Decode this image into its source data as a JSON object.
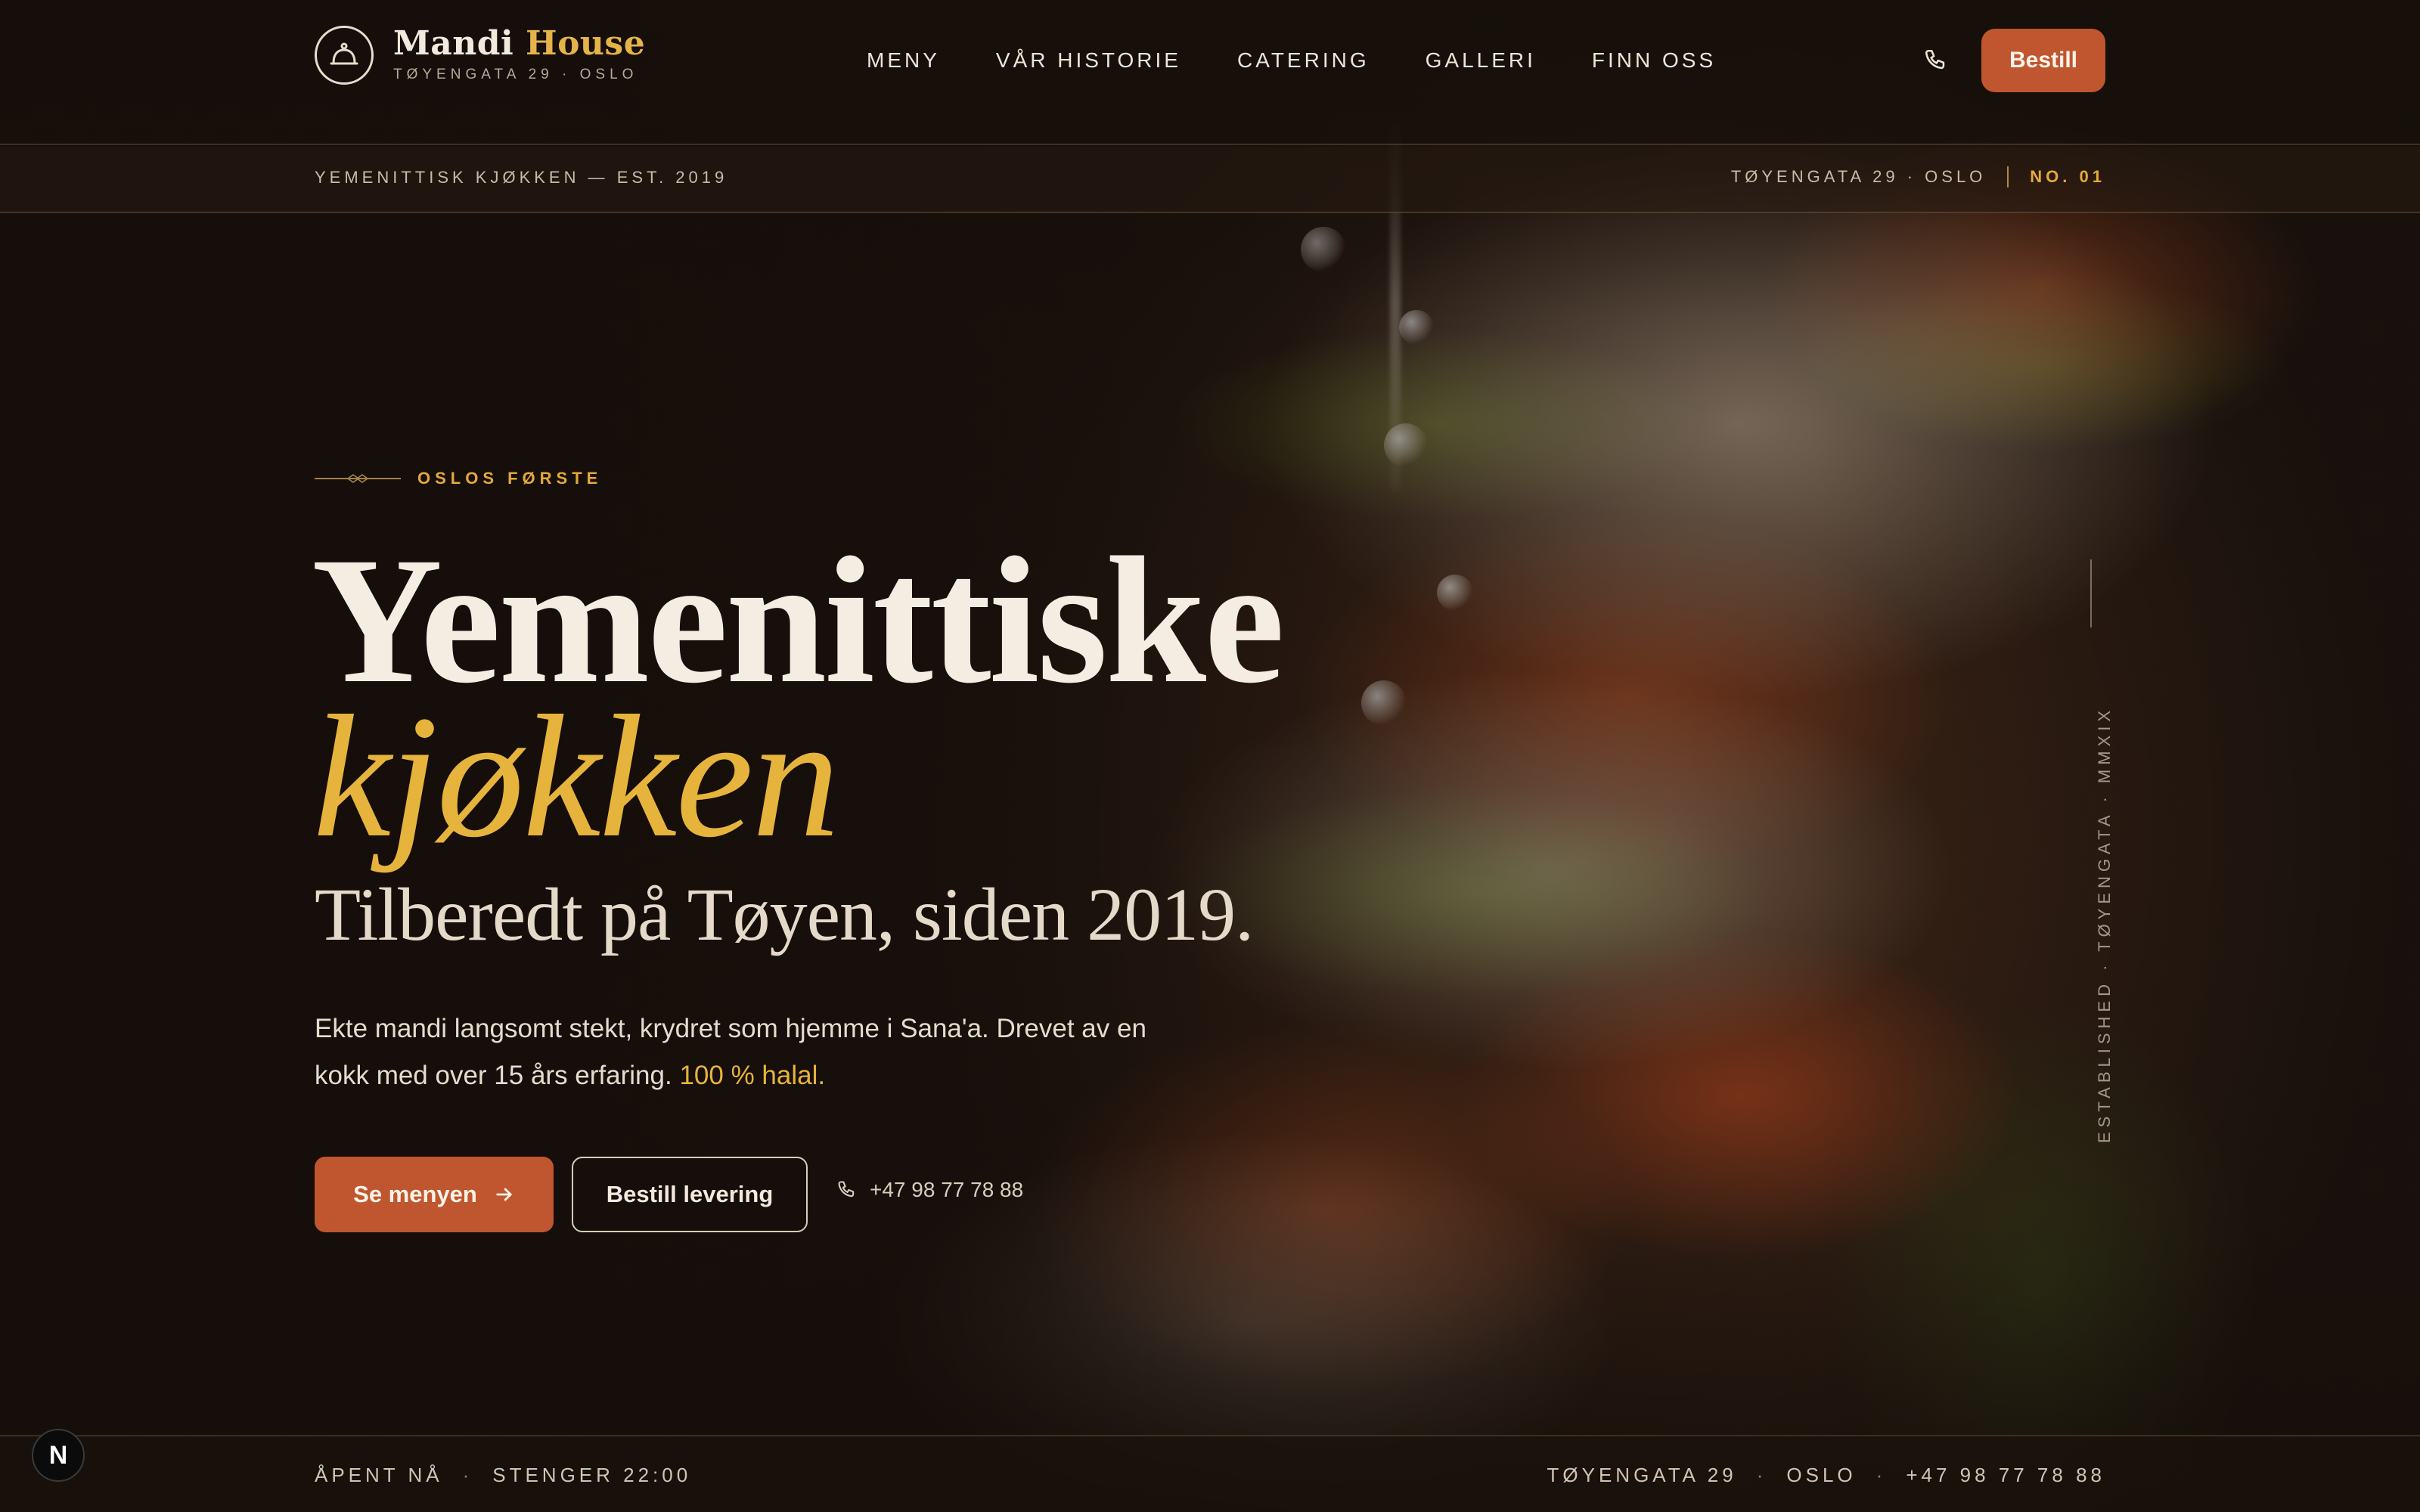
{
  "brand": {
    "name_main": "Mandi",
    "name_accent": "House",
    "subtitle": "TØYENGATA 29 · OSLO",
    "logo_icon": "cloche-icon"
  },
  "nav": {
    "items": [
      "MENY",
      "VÅR HISTORIE",
      "CATERING",
      "GALLERI",
      "FINN OSS"
    ]
  },
  "header": {
    "phone_icon": "phone-icon",
    "order_label": "Bestill"
  },
  "subbar": {
    "left": "YEMENITTISK KJØKKEN — EST. 2019",
    "address": "TØYENGATA 29 · OSLO",
    "issue": "NO. 01"
  },
  "hero": {
    "eyebrow": "OSLOS FØRSTE",
    "title_line1": "Yemenittiske",
    "title_line2": "kjøkken",
    "title_line3": "Tilberedt på Tøyen, siden 2019.",
    "lede": "Ekte mandi langsomt stekt, krydret som hjemme i Sana'a. Drevet av en kokk med over 15 års erfaring.",
    "lede_highlight": "100 % halal.",
    "cta_primary": "Se menyen",
    "cta_secondary": "Bestill levering",
    "phone": "+47 98 77 78 88",
    "vertical_text": "ESTABLISHED · TØYENGATA · MMXIX"
  },
  "footer": {
    "status": "ÅPENT NÅ",
    "closes": "STENGER 22:00",
    "street": "TØYENGATA 29",
    "city": "OSLO",
    "phone": "+47 98 77 78 88"
  },
  "dev_badge": "N",
  "colors": {
    "accent": "#c0562f",
    "gold": "#e6b43c",
    "background": "#1c130e"
  }
}
